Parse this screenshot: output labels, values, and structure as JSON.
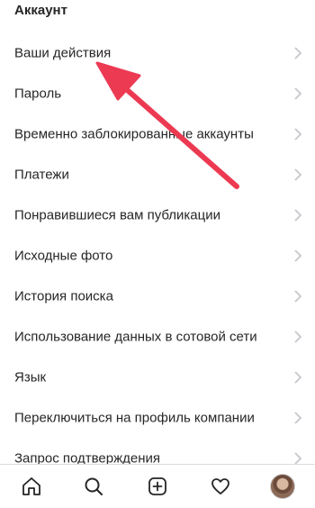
{
  "section_title": "Аккаунт",
  "menu": {
    "items": [
      {
        "label": "Ваши действия"
      },
      {
        "label": "Пароль"
      },
      {
        "label": "Временно заблокированные аккаунты"
      },
      {
        "label": "Платежи"
      },
      {
        "label": "Понравившиеся вам публикации"
      },
      {
        "label": "Исходные фото"
      },
      {
        "label": "История поиска"
      },
      {
        "label": "Использование данных в сотовой сети"
      },
      {
        "label": "Язык"
      },
      {
        "label": "Переключиться на профиль компании"
      },
      {
        "label": "Запрос подтверждения"
      }
    ]
  },
  "tab_bar": {
    "tabs": [
      {
        "icon": "home-icon"
      },
      {
        "icon": "search-icon"
      },
      {
        "icon": "add-post-icon"
      },
      {
        "icon": "heart-icon"
      },
      {
        "icon": "profile-avatar"
      }
    ]
  },
  "colors": {
    "text": "#262626",
    "chevron": "#c7c7cc",
    "annotation_arrow": "#ec3a52",
    "divider": "#dbdbdb"
  }
}
